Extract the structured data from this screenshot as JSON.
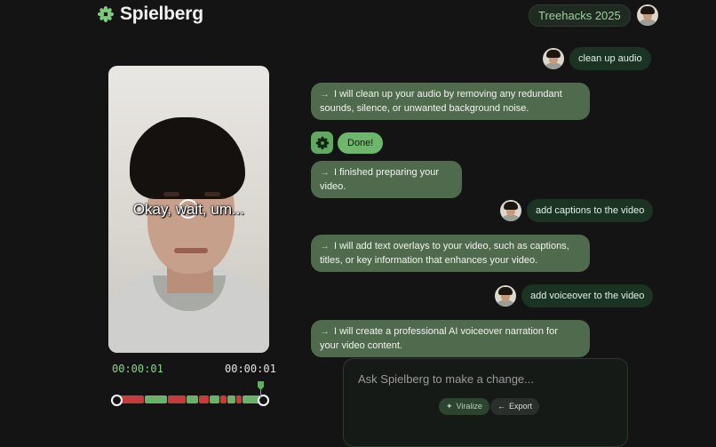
{
  "header": {
    "app_name": "Spielberg",
    "logo_icon": "asterisk-flower-icon",
    "event_label": "Treehacks 2025",
    "avatar_icon": "user-avatar"
  },
  "video": {
    "caption": "Okay, wait, um...",
    "current_time": "00:00:01",
    "total_time": "00:00:01",
    "play_icon": "play-icon"
  },
  "chat": {
    "messages": [
      {
        "role": "user",
        "text": "clean up audio"
      },
      {
        "role": "assistant",
        "text": "I will clean up your audio by removing any redundant sounds, silence, or unwanted background noise."
      },
      {
        "role": "status",
        "text": "Done!"
      },
      {
        "role": "assistant",
        "text": "I finished preparing your video."
      },
      {
        "role": "user",
        "text": "add captions to the video"
      },
      {
        "role": "assistant",
        "text": "I will add text overlays to your video, such as captions, titles, or key information that enhances your video."
      },
      {
        "role": "user",
        "text": "add voiceover to the video"
      },
      {
        "role": "assistant",
        "text": "I will create a professional AI voiceover narration for your video content."
      }
    ]
  },
  "prompt": {
    "placeholder": "Ask Spielberg to make a change...",
    "viralize_label": "Viralize",
    "export_label": "Export"
  },
  "colors": {
    "background": "#141414",
    "accent_green": "#6fb66d",
    "assistant_bubble": "#4f6a4c",
    "user_bubble": "#1a3322",
    "timeline_red": "#c43c3c",
    "timeline_green": "#6ab16a"
  }
}
